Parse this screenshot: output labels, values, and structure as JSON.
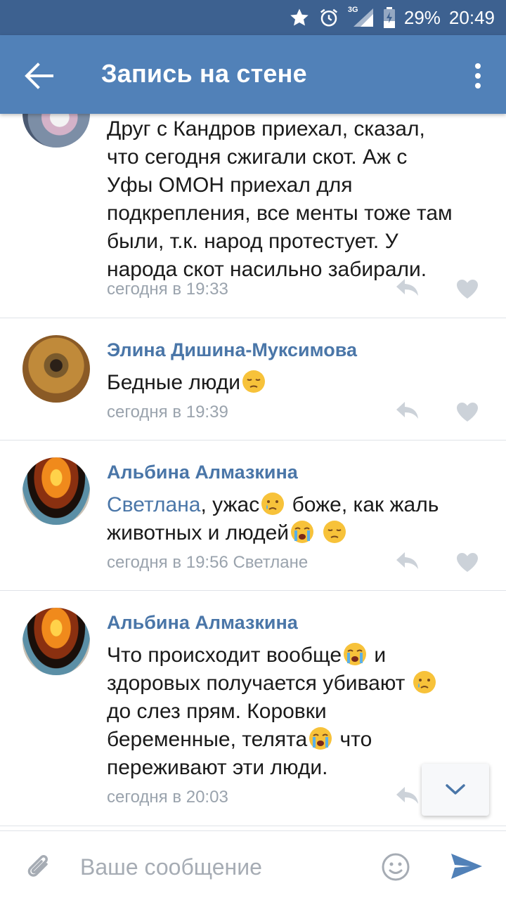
{
  "status_bar": {
    "network": "3G",
    "battery": "29%",
    "time": "20:49"
  },
  "app_bar": {
    "title": "Запись на стене"
  },
  "comments": [
    {
      "text_lines": [
        "Друг с Кандров приехал, сказал,",
        "что сегодня сжигали скот. Аж с",
        "Уфы ОМОН приехал для",
        "подкрепления, все менты тоже там",
        "были, т.к. народ протестует. У",
        "народа скот насильно забирали."
      ],
      "time": "сегодня в 19:33"
    },
    {
      "author": "Элина Дишина-Муксимова",
      "text": "Бедные люди",
      "time": "сегодня в 19:39"
    },
    {
      "author": "Альбина Алмазкина",
      "mention": "Светлана",
      "text_1": ", ужас",
      "text_2": " боже, как жаль",
      "text_3": "животных и людей",
      "time": "сегодня в 19:56",
      "reply_to": "Светлане"
    },
    {
      "author": "Альбина Алмазкина",
      "line_1": "Что происходит вообще",
      "line_1b": " и",
      "line_2": "здоровых получается убивают",
      "line_3": "до слез прям. Коровки",
      "line_4": "беременные, телята",
      "line_4b": " что",
      "line_5": "переживают эти люди.",
      "time": "сегодня в 20:03"
    }
  ],
  "composer": {
    "placeholder": "Ваше сообщение"
  },
  "icons": {
    "back": "arrow-back-icon",
    "more": "more-vertical-icon",
    "reply": "reply-icon",
    "like": "heart-icon",
    "scroll_down": "chevron-down-icon",
    "attach": "paperclip-icon",
    "emoji": "smile-icon",
    "send": "send-icon"
  },
  "colors": {
    "status_bar": "#3d6190",
    "app_bar": "#5181b8",
    "link": "#4a76a8",
    "meta": "#9aa3ad"
  }
}
